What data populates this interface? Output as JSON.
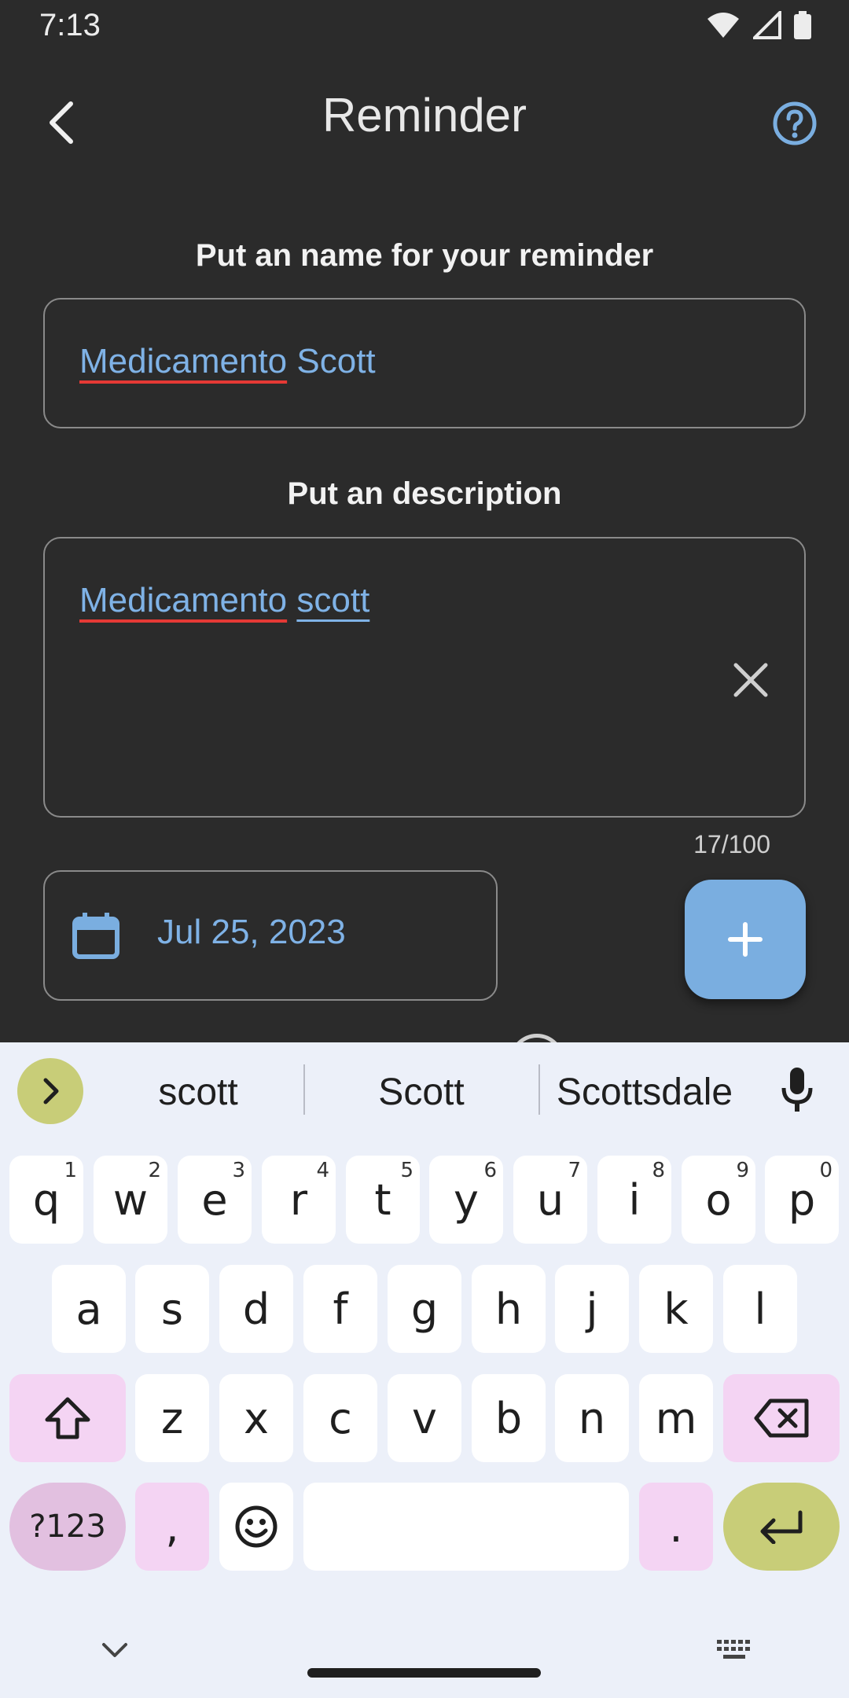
{
  "status_bar": {
    "time": "7:13"
  },
  "header": {
    "title": "Reminder"
  },
  "form": {
    "name_label": "Put an name for your reminder",
    "name_word1": "Medicamento",
    "name_word2": "Scott",
    "description_label": "Put an description",
    "desc_word1": "Medicamento",
    "desc_word2": "scott",
    "char_counter": "17/100",
    "date_value": "Jul 25, 2023"
  },
  "keyboard": {
    "suggestions": [
      "scott",
      "Scott",
      "Scottsdale"
    ],
    "row1": [
      {
        "k": "q",
        "h": "1"
      },
      {
        "k": "w",
        "h": "2"
      },
      {
        "k": "e",
        "h": "3"
      },
      {
        "k": "r",
        "h": "4"
      },
      {
        "k": "t",
        "h": "5"
      },
      {
        "k": "y",
        "h": "6"
      },
      {
        "k": "u",
        "h": "7"
      },
      {
        "k": "i",
        "h": "8"
      },
      {
        "k": "o",
        "h": "9"
      },
      {
        "k": "p",
        "h": "0"
      }
    ],
    "row2": [
      "a",
      "s",
      "d",
      "f",
      "g",
      "h",
      "j",
      "k",
      "l"
    ],
    "row3": [
      "z",
      "x",
      "c",
      "v",
      "b",
      "n",
      "m"
    ],
    "symbols_label": "?123",
    "comma": ",",
    "period": "."
  },
  "colors": {
    "background": "#2b2b2b",
    "accent": "#7aaee0",
    "spell_error": "#e53935",
    "keyboard_bg": "#ecf0f9",
    "key_olive": "#c8cd78",
    "key_pink": "#f4d4f3"
  },
  "icons": [
    "wifi-icon",
    "signal-icon",
    "battery-icon",
    "back-arrow-icon",
    "help-icon",
    "clear-icon",
    "calendar-icon",
    "plus-icon",
    "chevron-right-icon",
    "microphone-icon",
    "shift-icon",
    "backspace-icon",
    "emoji-icon",
    "enter-icon",
    "chevron-down-icon",
    "keyboard-icon"
  ]
}
